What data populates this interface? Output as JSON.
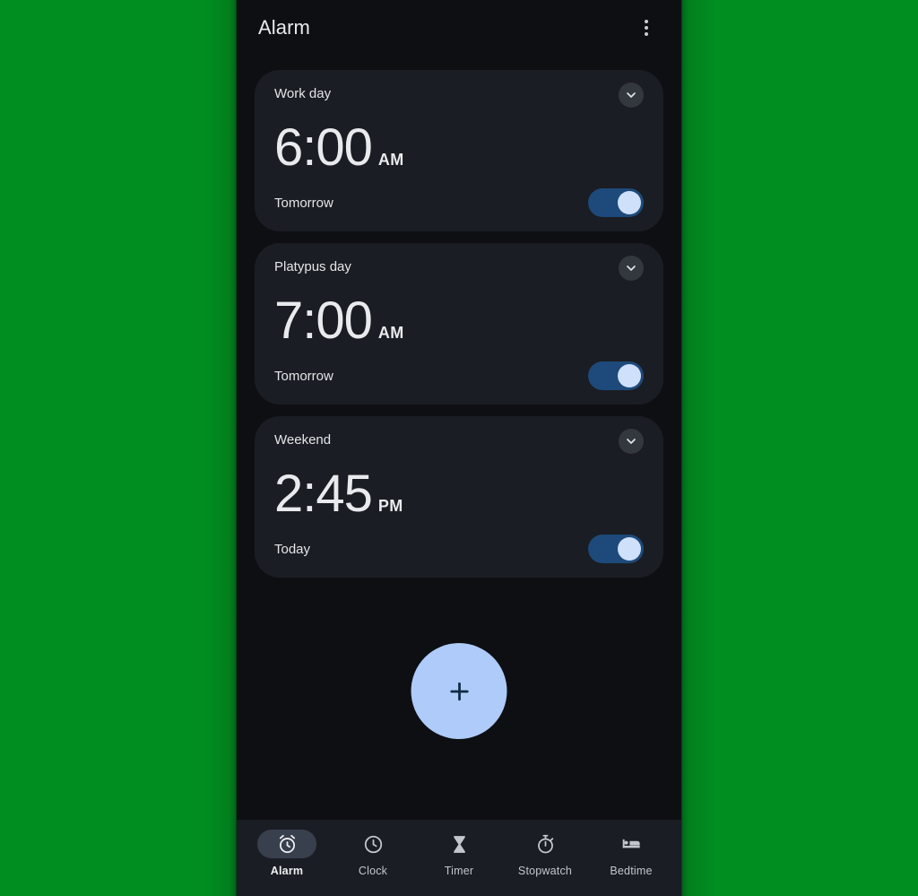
{
  "app": {
    "title": "Alarm",
    "overflow_menu": "more-options"
  },
  "alarms": [
    {
      "label": "Work day",
      "time": "6:00",
      "period": "AM",
      "when": "Tomorrow",
      "enabled": true
    },
    {
      "label": "Platypus day",
      "time": "7:00",
      "period": "AM",
      "when": "Tomorrow",
      "enabled": true
    },
    {
      "label": "Weekend",
      "time": "2:45",
      "period": "PM",
      "when": "Today",
      "enabled": true
    }
  ],
  "fab": {
    "label": "+",
    "name": "add-alarm",
    "background": "#aecbfa",
    "icon_color": "#102a43"
  },
  "bottom_nav": {
    "active": "Alarm",
    "items": [
      {
        "label": "Alarm",
        "icon": "alarm-icon"
      },
      {
        "label": "Clock",
        "icon": "clock-icon"
      },
      {
        "label": "Timer",
        "icon": "hourglass-icon"
      },
      {
        "label": "Stopwatch",
        "icon": "stopwatch-icon"
      },
      {
        "label": "Bedtime",
        "icon": "bed-icon"
      }
    ]
  },
  "colors": {
    "desktop_background": "#038d21",
    "screen_background": "#0e0f13",
    "card_background": "#1a1d23",
    "toggle_track_on": "#1d4a7a",
    "toggle_thumb_on": "#cfe0fb",
    "nav_active_pill": "#39404d",
    "accent": "#aecbfa"
  }
}
